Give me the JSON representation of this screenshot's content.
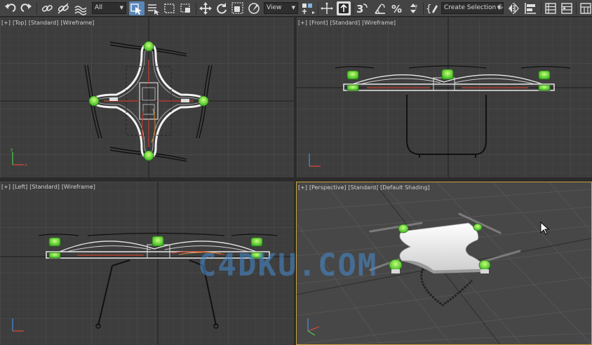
{
  "toolbar": {
    "filter_value": "All",
    "refcoord_value": "View",
    "selection_set_value": "Create Selection Se",
    "snap_label": "3",
    "angle_snap_label": "△",
    "percent_label": "%"
  },
  "viewports": {
    "top": {
      "plus": "[+]",
      "name": "[Top]",
      "shading": "[Standard]",
      "mode": "[Wireframe]"
    },
    "front": {
      "plus": "[+]",
      "name": "[Front]",
      "shading": "[Standard]",
      "mode": "[Wireframe]"
    },
    "left": {
      "plus": "[+]",
      "name": "[Left]",
      "shading": "[Standard]",
      "mode": "[Wireframe]"
    },
    "perspective": {
      "plus": "[+]",
      "name": "[Perspective]",
      "shading": "[Standard]",
      "mode": "[Default Shading]"
    }
  },
  "watermark": "C4DKU.COM",
  "colors": {
    "viewport_bg": "#3d3d3d",
    "grid": "#474747",
    "active_border": "#c9a13a",
    "motor_green": "#57d433",
    "frame_white": "#f2f2f2"
  }
}
